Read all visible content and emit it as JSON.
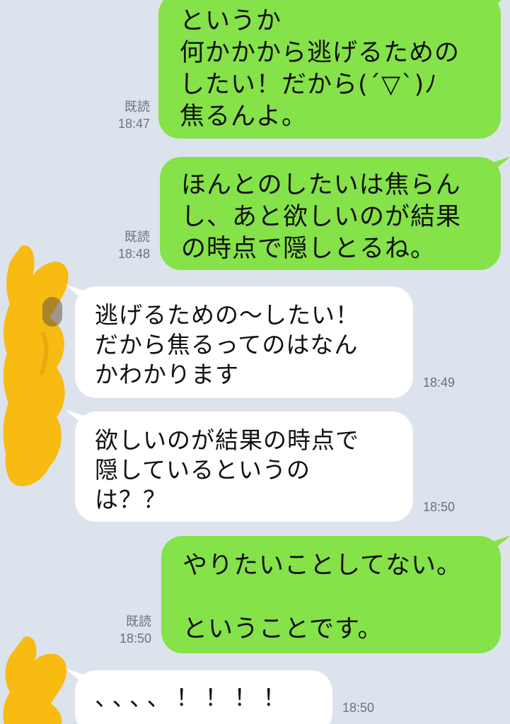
{
  "messages": [
    {
      "direction": "out",
      "text": "というか\n何かかから逃げるための\nしたい！だから(´▽`)ﾉ\n焦るんよ。",
      "read_label": "既読",
      "time": "18:47"
    },
    {
      "direction": "out",
      "text": "ほんとのしたいは焦らん\nし、あと欲しいのが結果\nの時点で隠しとるね。",
      "read_label": "既読",
      "time": "18:48"
    },
    {
      "direction": "in",
      "text": "逃げるための〜したい！\nだから焦るってのはなん\nかわかります",
      "time": "18:49"
    },
    {
      "direction": "in",
      "text": "欲しいのが結果の時点で\n隠しているというの\nは？？",
      "time": "18:50"
    },
    {
      "direction": "out",
      "text": "やりたいことしてない。\n\nということです。",
      "read_label": "既読",
      "time": "18:50"
    },
    {
      "direction": "in",
      "text": "、、、、！！！！",
      "time": "18:50"
    }
  ],
  "colors": {
    "background": "#dde3ec",
    "sent_bubble": "#85e249",
    "received_bubble": "#ffffff",
    "avatar_scribble": "#f7bb12",
    "meta_text": "#6a7380"
  }
}
